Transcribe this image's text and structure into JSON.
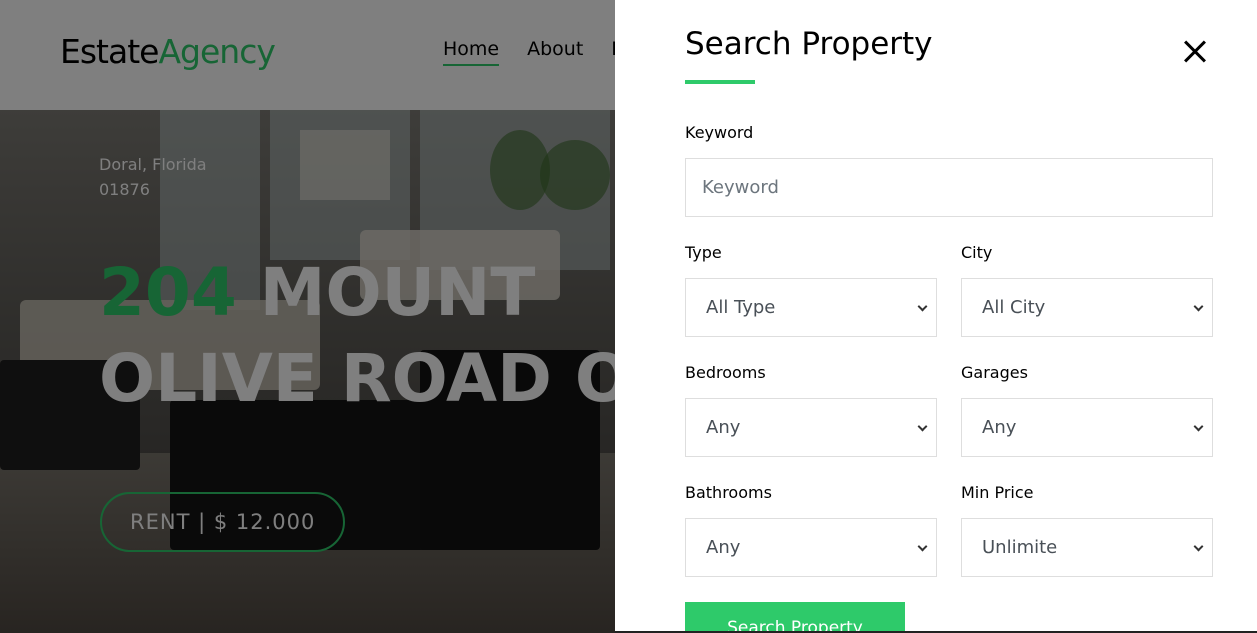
{
  "brand": {
    "name_part1": "Estate",
    "name_part2": "Agency"
  },
  "nav": {
    "items": [
      "Home",
      "About",
      "P"
    ]
  },
  "hero": {
    "location_line1": "Doral, Florida",
    "location_line2": "01876",
    "title_number": "204",
    "title_rest_line1": "MOUNT",
    "title_line2": "OLIVE ROAD OI",
    "price_label": "RENT | $ 12.000"
  },
  "search": {
    "title": "Search Property",
    "keyword_label": "Keyword",
    "keyword_placeholder": "Keyword",
    "type_label": "Type",
    "type_value": "All Type",
    "city_label": "City",
    "city_value": "All City",
    "bedrooms_label": "Bedrooms",
    "bedrooms_value": "Any",
    "garages_label": "Garages",
    "garages_value": "Any",
    "bathrooms_label": "Bathrooms",
    "bathrooms_value": "Any",
    "min_price_label": "Min Price",
    "min_price_value": "Unlimite",
    "submit_label": "Search Property"
  },
  "colors": {
    "accent": "#2eca6a",
    "text": "#000000",
    "border": "#dedede"
  },
  "icons": {
    "close": "close-icon",
    "dropdown": "chevron-down-icon"
  }
}
